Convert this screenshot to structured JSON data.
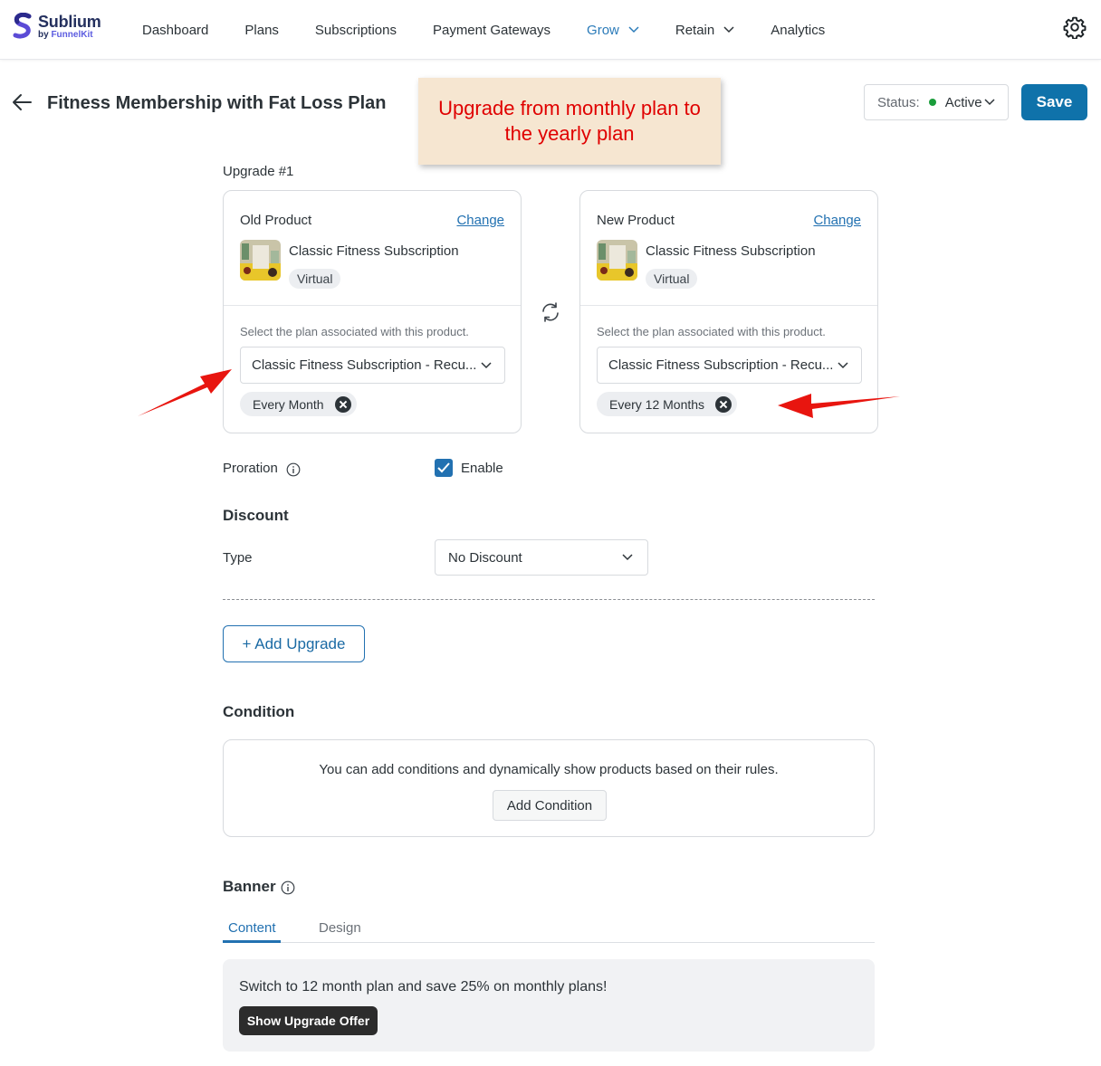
{
  "app": {
    "logo_name": "Sublium",
    "logo_by": "by ",
    "logo_brand": "FunnelKit",
    "brand_color": "#24305e"
  },
  "nav": {
    "items": [
      {
        "label": "Dashboard",
        "active": false,
        "dropdown": false
      },
      {
        "label": "Plans",
        "active": false,
        "dropdown": false
      },
      {
        "label": "Subscriptions",
        "active": false,
        "dropdown": false
      },
      {
        "label": "Payment Gateways",
        "active": false,
        "dropdown": false
      },
      {
        "label": "Grow",
        "active": true,
        "dropdown": true
      },
      {
        "label": "Retain",
        "active": false,
        "dropdown": true
      },
      {
        "label": "Analytics",
        "active": false,
        "dropdown": false
      }
    ],
    "settings_icon": "gear-icon"
  },
  "header": {
    "title": "Fitness Membership with Fat Loss Plan",
    "status_label": "Status:",
    "status_value": "Active",
    "status_color": "#1a9d3b",
    "save_label": "Save",
    "save_color": "#0f72aa"
  },
  "annotation": {
    "note": "Upgrade from monthly plan to the yearly plan",
    "color": "#e00000"
  },
  "upgrade": {
    "label": "Upgrade #1",
    "old": {
      "heading": "Old Product",
      "change_label": "Change",
      "product_name": "Classic Fitness Subscription",
      "tag": "Virtual",
      "hint": "Select the plan associated with this product.",
      "plan_value": "Classic Fitness Subscription - Recu...",
      "interval": "Every Month"
    },
    "new": {
      "heading": "New Product",
      "change_label": "Change",
      "product_name": "Classic Fitness Subscription",
      "tag": "Virtual",
      "hint": "Select the plan associated with this product.",
      "plan_value": "Classic Fitness Subscription - Recu...",
      "interval": "Every 12 Months"
    }
  },
  "proration": {
    "label": "Proration",
    "checkbox_label": "Enable",
    "checked": true
  },
  "discount": {
    "heading": "Discount",
    "type_label": "Type",
    "type_value": "No Discount"
  },
  "add_upgrade_label": "+ Add Upgrade",
  "condition": {
    "heading": "Condition",
    "text": "You can add conditions and dynamically show products based on their rules.",
    "button_label": "Add Condition"
  },
  "banner": {
    "heading": "Banner",
    "tabs": [
      {
        "label": "Content",
        "active": true
      },
      {
        "label": "Design",
        "active": false
      }
    ],
    "text": "Switch to 12 month plan and save 25% on monthly plans!",
    "button_label": "Show Upgrade Offer"
  }
}
